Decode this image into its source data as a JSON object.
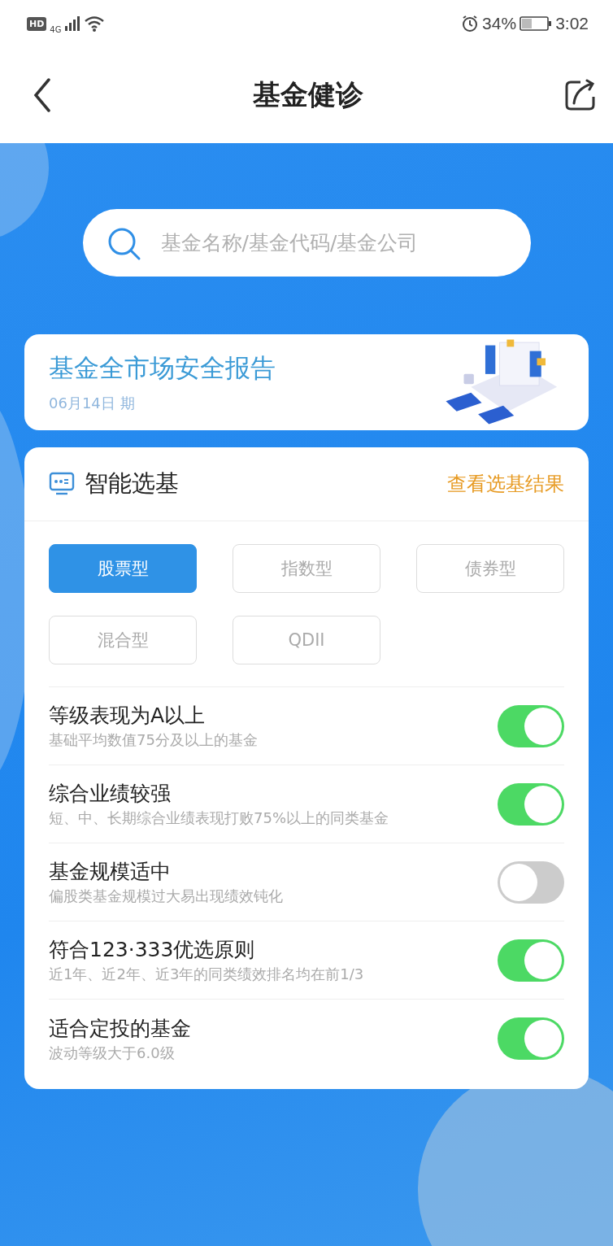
{
  "status_bar": {
    "hd": "HD",
    "network": "4G",
    "battery": "34%",
    "time": "3:02"
  },
  "header": {
    "title": "基金健诊"
  },
  "search": {
    "placeholder": "基金名称/基金代码/基金公司"
  },
  "report": {
    "title": "基金全市场安全报告",
    "date": "06月14日 期"
  },
  "selector": {
    "title": "智能选基",
    "link": "查看选基结果",
    "types": [
      {
        "label": "股票型",
        "selected": true
      },
      {
        "label": "指数型",
        "selected": false
      },
      {
        "label": "债券型",
        "selected": false
      },
      {
        "label": "混合型",
        "selected": false
      },
      {
        "label": "QDII",
        "selected": false
      }
    ],
    "filters": [
      {
        "title": "等级表现为A以上",
        "desc": "基础平均数值75分及以上的基金",
        "on": true
      },
      {
        "title": "综合业绩较强",
        "desc": "短、中、长期综合业绩表现打败75%以上的同类基金",
        "on": true
      },
      {
        "title": "基金规模适中",
        "desc": "偏股类基金规模过大易出现绩效钝化",
        "on": false
      },
      {
        "title": "符合123·333优选原则",
        "desc": "近1年、近2年、近3年的同类绩效排名均在前1/3",
        "on": true
      },
      {
        "title": "适合定投的基金",
        "desc": "波动等级大于6.0级",
        "on": true
      }
    ]
  }
}
